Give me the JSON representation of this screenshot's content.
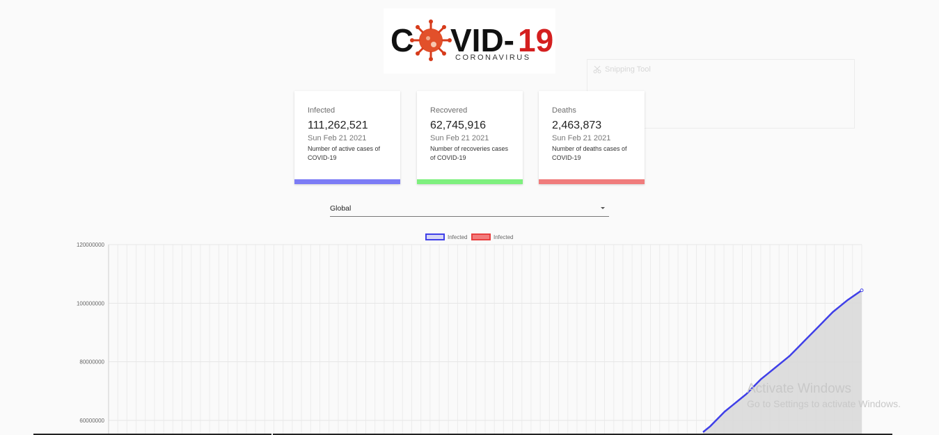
{
  "logo": {
    "brand": "COVID-19",
    "subtitle": "CORONAVIRUS"
  },
  "snipping_tool": {
    "title": "Snipping Tool"
  },
  "cards": [
    {
      "title": "Infected",
      "count": "111,262,521",
      "date": "Sun Feb 21 2021",
      "description": "Number of active cases of COVID-19",
      "accent": "#7c7cf5"
    },
    {
      "title": "Recovered",
      "count": "62,745,916",
      "date": "Sun Feb 21 2021",
      "description": "Number of recoveries cases of COVID-19",
      "accent": "#7ef07e"
    },
    {
      "title": "Deaths",
      "count": "2,463,873",
      "date": "Sun Feb 21 2021",
      "description": "Number of deaths cases of COVID-19",
      "accent": "#f07c7c"
    }
  ],
  "country_select": {
    "value": "Global"
  },
  "watermark": {
    "line1": "Activate Windows",
    "line2": "Go to Settings to activate Windows."
  },
  "chart_data": {
    "type": "line",
    "legend": [
      "Infected",
      "Infected"
    ],
    "legend_placement": "top-center",
    "series": [
      {
        "name": "Infected",
        "color": "#3f3fe8",
        "fill": "#d9d9d9",
        "values": [
          56000000,
          58000000,
          60500000,
          63000000,
          65000000,
          67000000,
          69000000,
          71500000,
          74000000,
          76000000,
          78000000,
          80000000,
          82000000,
          84500000,
          87000000,
          89500000,
          92000000,
          94500000,
          97000000,
          99000000,
          101000000,
          102700000,
          104400000
        ]
      }
    ],
    "y_ticks": [
      "120000000",
      "100000000",
      "80000000",
      "60000000"
    ],
    "ylim": [
      56000000,
      120000000
    ],
    "grid": true
  }
}
